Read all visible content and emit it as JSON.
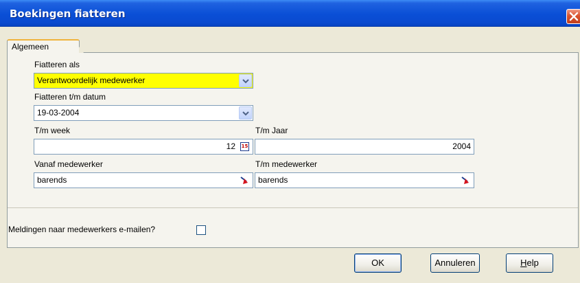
{
  "window": {
    "title": "Boekingen fiatteren"
  },
  "tabs": [
    {
      "label": "Algemeen"
    }
  ],
  "form": {
    "fiatteren_als": {
      "label": "Fiatteren als",
      "value": "Verantwoordelijk medewerker"
    },
    "fiatteren_tm_datum": {
      "label": "Fiatteren t/m datum",
      "value": "19-03-2004"
    },
    "tm_week": {
      "label": "T/m week",
      "value": "12"
    },
    "tm_jaar": {
      "label": "T/m Jaar",
      "value": "2004"
    },
    "vanaf_medewerker": {
      "label": "Vanaf medewerker",
      "value": "barends"
    },
    "tm_medewerker": {
      "label": "T/m medewerker",
      "value": "barends"
    },
    "email_checkbox": {
      "label": "Meldingen naar medewerkers e-mailen?",
      "checked": false
    }
  },
  "buttons": {
    "ok": "OK",
    "cancel": "Annuleren",
    "help_first": "H",
    "help_rest": "elp"
  },
  "calendar_icon_text": "15",
  "colors": {
    "highlight_field": "#ffff00",
    "titlebar": "#0a4fd6",
    "dialog_bg": "#ece9d8"
  },
  "icons": [
    "close-icon",
    "chevron-down-icon",
    "calendar-icon",
    "picker-icon"
  ]
}
